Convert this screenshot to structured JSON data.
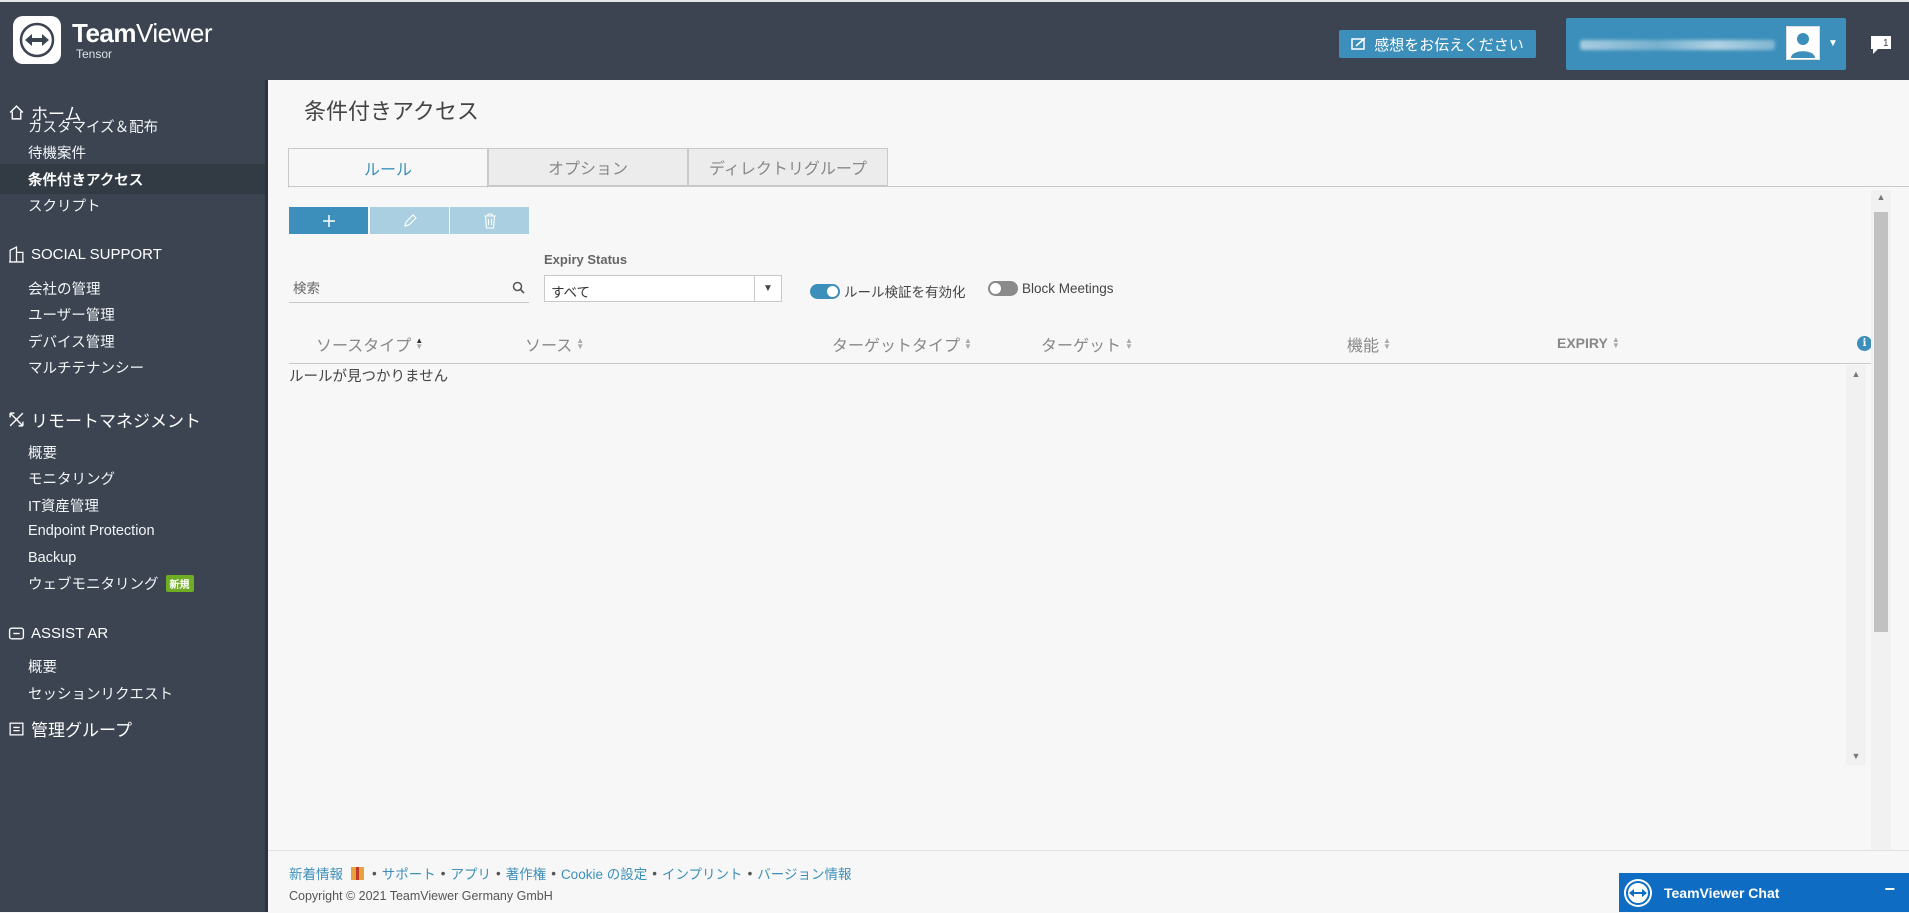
{
  "header": {
    "brand_bold": "Team",
    "brand_light": "Viewer",
    "brand_sub": "Tensor",
    "feedback_label": "感想をお伝えください",
    "notification_count": "1",
    "icons": {
      "feedback": "feedback-icon",
      "avatar": "user-avatar-icon",
      "notification": "chat-bubble-icon"
    }
  },
  "sidebar": {
    "sections": [
      {
        "title": "ホーム",
        "icon": "home-icon",
        "items": [
          "カスタマイズ＆配布",
          "待機案件",
          "条件付きアクセス",
          "スクリプト"
        ]
      },
      {
        "title": "SOCIAL SUPPORT",
        "icon": "building-icon",
        "items": [
          "会社の管理",
          "ユーザー管理",
          "デバイス管理",
          "マルチテナンシー"
        ]
      },
      {
        "title": "リモートマネジメント",
        "icon": "remote-icon",
        "items": [
          "概要",
          "モニタリング",
          "IT資産管理",
          "Endpoint Protection",
          "Backup",
          "ウェブモニタリング"
        ]
      },
      {
        "title": "ASSIST AR",
        "icon": "ar-icon",
        "items": [
          "概要",
          "セッションリクエスト"
        ]
      },
      {
        "title": "管理グループ",
        "icon": "group-icon",
        "items": []
      }
    ],
    "active_item": "条件付きアクセス",
    "new_badge": "新規"
  },
  "main": {
    "page_title": "条件付きアクセス",
    "tabs": [
      "ルール",
      "オプション",
      "ディレクトリグループ"
    ],
    "active_tab": "ルール",
    "search_placeholder": "検索",
    "expiry_label": "Expiry Status",
    "expiry_value": "すべて",
    "toggle_rules_label": "ルール検証を有効化",
    "toggle_rules_on": true,
    "toggle_meetings_label": "Block Meetings",
    "toggle_meetings_on": false,
    "columns": [
      "ソースタイプ",
      "ソース",
      "ターゲットタイプ",
      "ターゲット",
      "機能",
      "EXPIRY"
    ],
    "empty_message": "ルールが見つかりません"
  },
  "footer": {
    "links": [
      "新着情報",
      "サポート",
      "アプリ",
      "著作権",
      "Cookie の設定",
      "インプリント",
      "バージョン情報"
    ],
    "copyright": "Copyright © 2021 TeamViewer Germany GmbH"
  },
  "chat": {
    "title": "TeamViewer Chat",
    "minimize": "−"
  },
  "colors": {
    "header_bg": "#3b4450",
    "accent": "#3c8fba",
    "new_badge": "#6fae23",
    "chat_bg": "#0e6dc2"
  }
}
